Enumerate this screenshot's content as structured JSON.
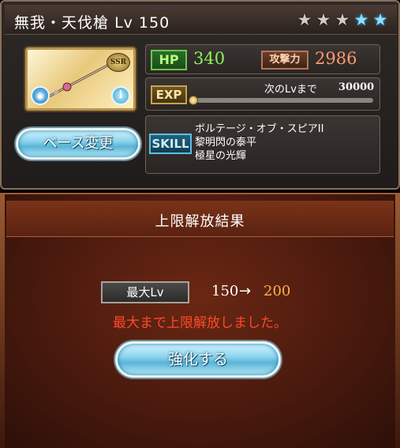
{
  "weapon": {
    "name": "無我・天伐槍",
    "level_text": "Lv 150",
    "rarity": "SSR",
    "element_icon": "water-element-icon",
    "stars": [
      {
        "type": "filled"
      },
      {
        "type": "filled"
      },
      {
        "type": "filled"
      },
      {
        "type": "blue"
      },
      {
        "type": "blue"
      }
    ]
  },
  "stats": {
    "hp_label": "HP",
    "hp_value": "340",
    "atk_label": "攻撃力",
    "atk_value": "2986",
    "exp_label": "EXP",
    "next_label": "次のLvまで",
    "next_value": "30000",
    "exp_progress": 0
  },
  "skill": {
    "label": "SKILL",
    "items": [
      "ボルテージ・オブ・スピアII",
      "黎明閃の泰平",
      "極星の光輝"
    ]
  },
  "buttons": {
    "base_change": "ベース変更",
    "enhance": "強化する"
  },
  "result": {
    "title": "上限解放結果",
    "max_label": "最大Lv",
    "old_level": "150",
    "arrow": "→",
    "new_level": "200",
    "message": "最大まで上限解放しました。"
  },
  "colors": {
    "hp": "#8bf25a",
    "atk": "#ff9a70",
    "new_level": "#ffb04a",
    "message": "#ff4a2a"
  }
}
